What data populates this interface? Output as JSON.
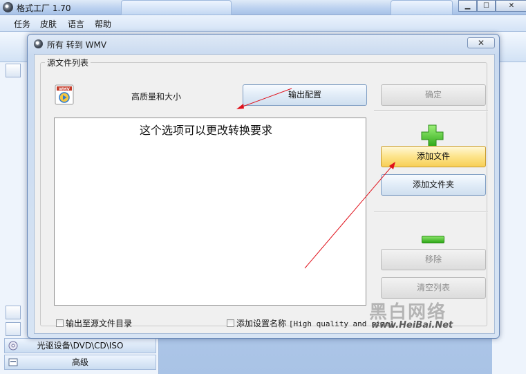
{
  "app": {
    "title": "格式工厂 1.70",
    "menus": [
      "任务",
      "皮肤",
      "语言",
      "帮助"
    ],
    "window_controls": {
      "minimize": "▁",
      "maximize": "☐",
      "close": "✕"
    }
  },
  "sidebar": {
    "bottom_rows": [
      {
        "label": "光驱设备\\DVD\\CD\\ISO",
        "icon": "disc-icon"
      },
      {
        "label": "高级",
        "icon": "advanced-icon"
      }
    ]
  },
  "dialog": {
    "title": "所有 转到 WMV",
    "close_glyph": "✕",
    "group_label": "源文件列表",
    "output_format_icon": "wmv-icon",
    "quality_label": "高质量和大小",
    "output_config_button": "输出配置",
    "ok_button": "确定",
    "file_list_note": "这个选项可以更改转换要求",
    "add_file_button": "添加文件",
    "add_folder_button": "添加文件夹",
    "remove_button": "移除",
    "clear_list_button": "清空列表",
    "checkbox_output_to_source": "输出至源文件目录",
    "checkbox_add_setting_name": "添加设置名称",
    "setting_name_value": "[High quality and size]"
  },
  "watermark": {
    "text_cn": "黑白网络",
    "url": "www.HeiBai.Net"
  },
  "colors": {
    "annotation_arrow": "#e0101a",
    "add_icon": "#3cb81f",
    "hot_button": "#f7cf57"
  }
}
